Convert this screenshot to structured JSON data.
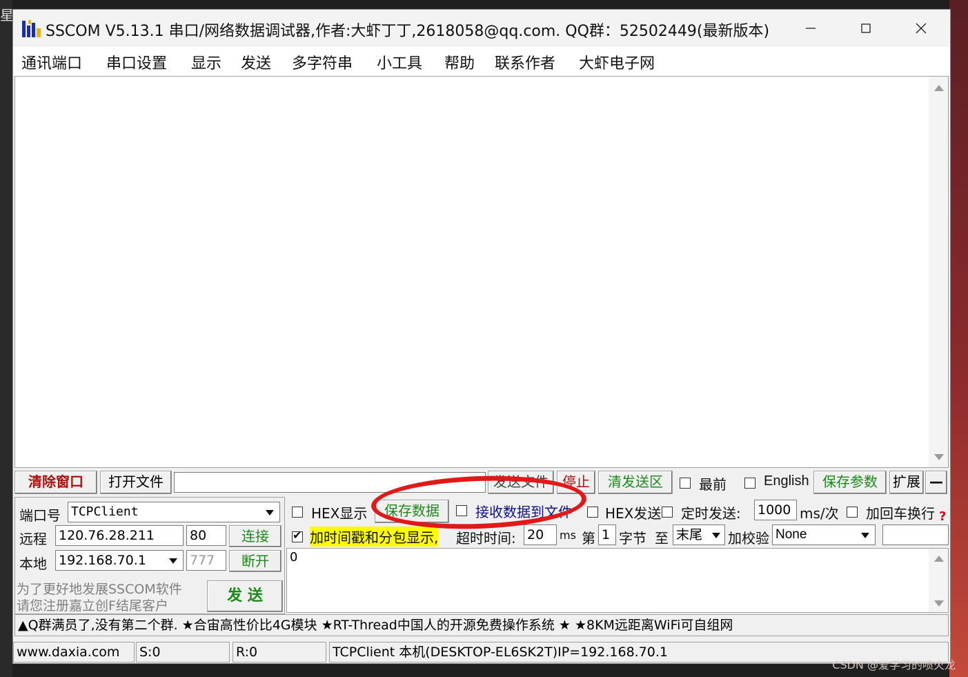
{
  "desktop": {
    "left_char": "星",
    "watermark": "CSDN @爱学习的喷火龙"
  },
  "window": {
    "title": "SSCOM V5.13.1 串口/网络数据调试器,作者:大虾丁丁,2618058@qq.com. QQ群：52502449(最新版本)"
  },
  "menu": [
    "通讯端口",
    "串口设置",
    "显示",
    "发送",
    "多字符串",
    "小工具",
    "帮助",
    "联系作者",
    "大虾电子网"
  ],
  "toolbar": {
    "clear_window": "清除窗口",
    "open_file": "打开文件",
    "file_path": "",
    "send_file": "发送文件",
    "stop": "停止",
    "clear_send": "清发送区",
    "topmost": "最前",
    "english": "English",
    "save_params": "保存参数",
    "expand": "扩展",
    "collapse": "—"
  },
  "connection": {
    "port_label": "端口号",
    "port_value": "TCPClient",
    "remote_label": "远程",
    "remote_ip": "120.76.28.211",
    "remote_port": "80",
    "connect": "连接",
    "local_label": "本地",
    "local_ip": "192.168.70.1",
    "local_port": "777",
    "disconnect": "断开",
    "promo_line1": "为了更好地发展SSCOM软件",
    "promo_line2": "请您注册嘉立创F结尾客户",
    "send": "发 送"
  },
  "options": {
    "hex_display": "HEX显示",
    "save_data": "保存数据",
    "recv_to_file": "接收数据到文件",
    "hex_send": "HEX发送",
    "timed_send": "定时发送:",
    "interval": "1000",
    "interval_unit": "ms/次",
    "add_crlf": "加回车换行",
    "timestamp": "加时间戳和分包显示,",
    "timeout_label": "超时时间:",
    "timeout_value": "20",
    "timeout_unit": "ms",
    "byte_prefix": "第",
    "byte_index": "1",
    "byte_suffix": "字节",
    "to_label": "至",
    "to_value": "末尾",
    "checksum_label": "加校验",
    "checksum_value": "None",
    "help": "?"
  },
  "send_area": {
    "text": "0"
  },
  "ticker": "▲Q群满员了,没有第二个群. ★合宙高性价比4G模块 ★RT-Thread中国人的开源免费操作系统 ★ ★8KM远距离WiFi可自组网",
  "status": {
    "site": "www.daxia.com",
    "sent": "S:0",
    "received": "R:0",
    "info": "TCPClient 本机(DESKTOP-EL6SK2T)IP=192.168.70.1"
  },
  "colors": {
    "clear_window_text": "#b01010",
    "green_text": "#1a8a1a",
    "blue_text": "#10108a",
    "stop_text": "#b01010",
    "timestamp_highlight": "#ffff00",
    "annotation_circle": "#e11919"
  }
}
